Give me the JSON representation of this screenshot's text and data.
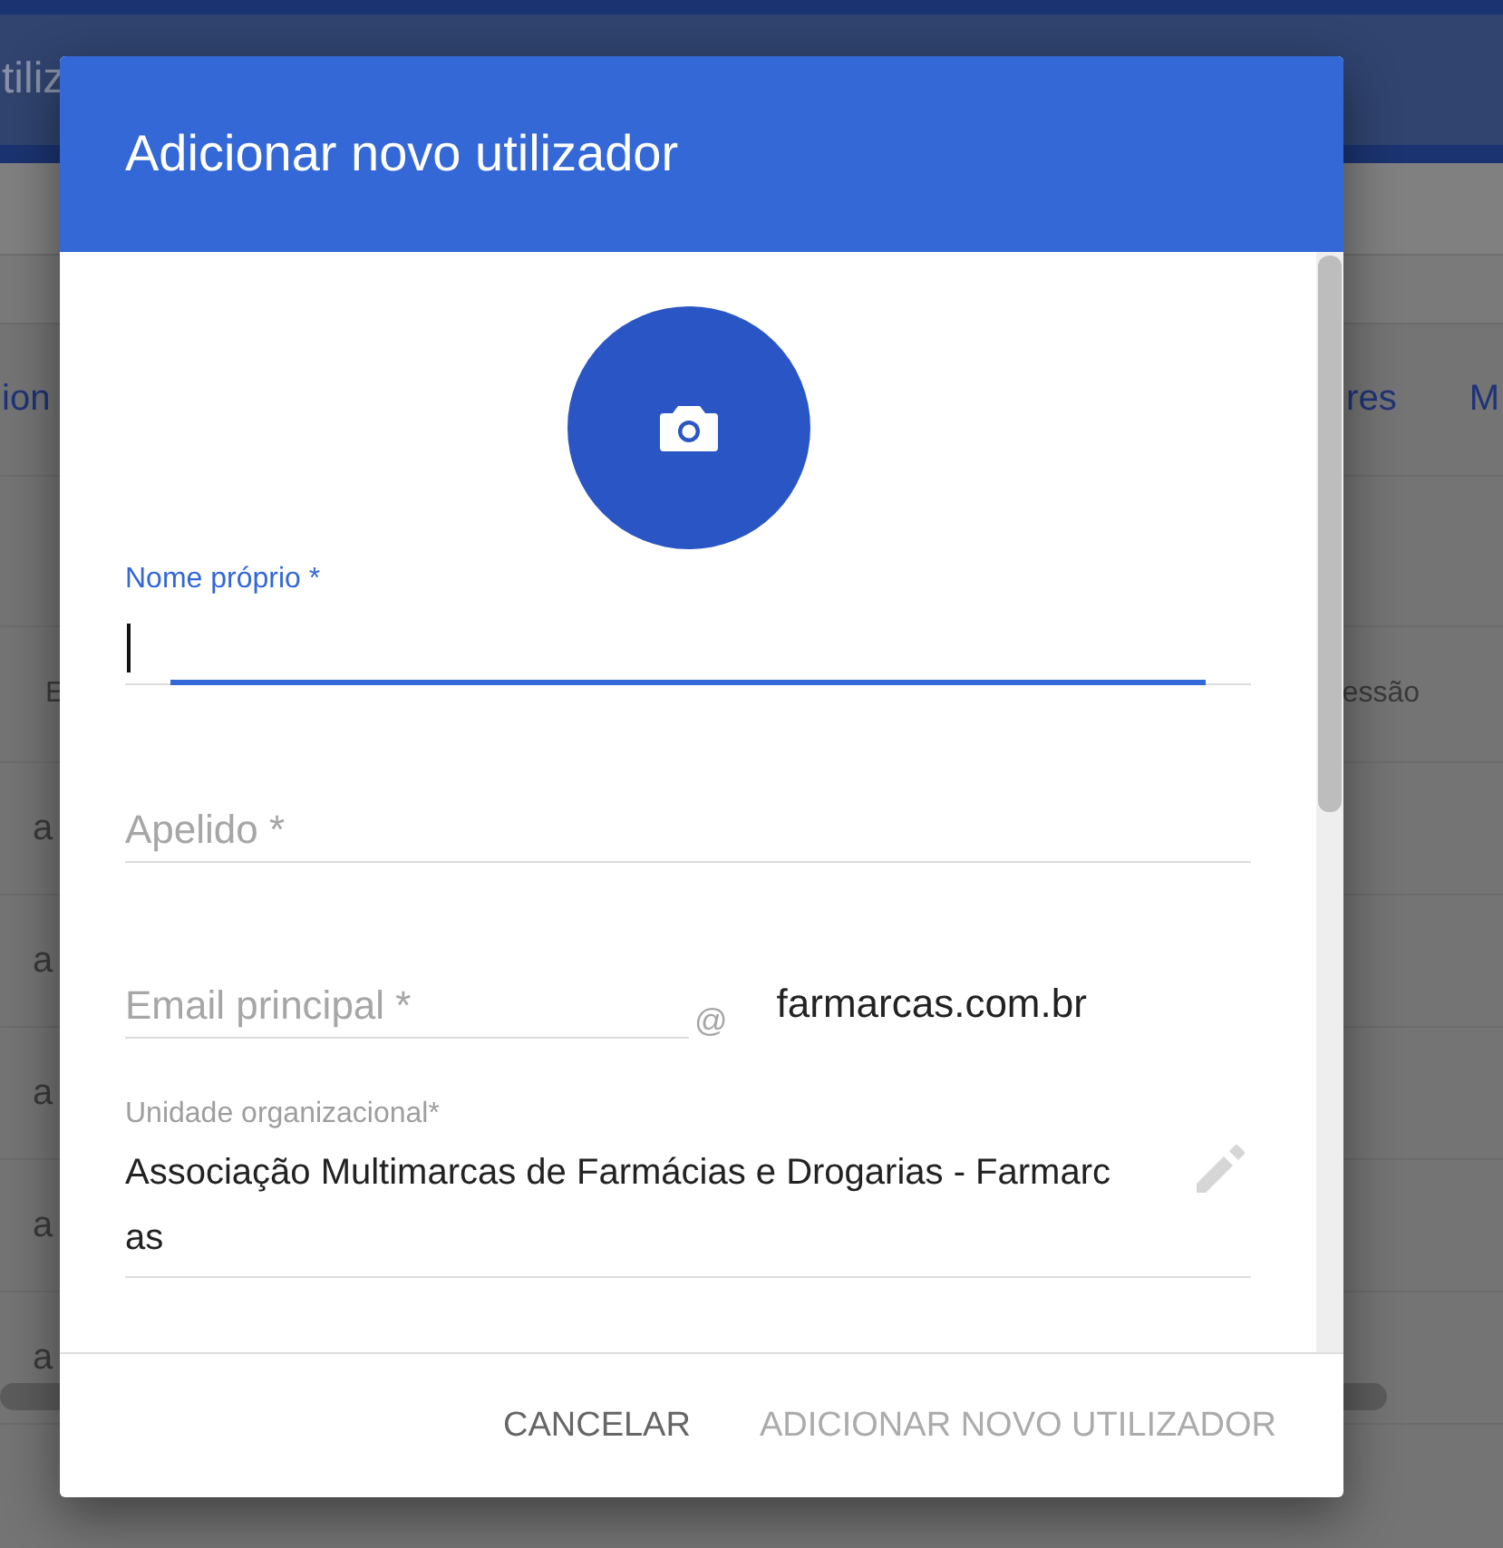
{
  "background": {
    "header_title": "tiliz",
    "tabs": [
      {
        "label": "ion"
      },
      {
        "label": "res"
      },
      {
        "label": "M"
      }
    ],
    "table": {
      "columns": [
        "E",
        "essão"
      ],
      "rows": [
        [
          "a"
        ],
        [
          "a"
        ],
        [
          "a"
        ],
        [
          "a"
        ],
        [
          "a"
        ]
      ]
    }
  },
  "dialog": {
    "title": "Adicionar novo utilizador",
    "fields": [
      {
        "kind": "text",
        "label": "Nome próprio *",
        "focused": true
      },
      {
        "kind": "text",
        "placeholder": "Apelido *",
        "focused": false
      },
      {
        "kind": "email",
        "placeholder": "Email principal *",
        "focused": false,
        "at": "@",
        "domain": "farmarcas.com.br"
      },
      {
        "kind": "select",
        "label": "Unidade organizacional*",
        "value": "Associação Multimarcas de Farmácias e Drogarias - Farmarcas"
      }
    ],
    "buttons": [
      {
        "label": "CANCELAR",
        "disabled": false
      },
      {
        "label": "ADICIONAR NOVO UTILIZADOR",
        "disabled": true
      }
    ]
  }
}
